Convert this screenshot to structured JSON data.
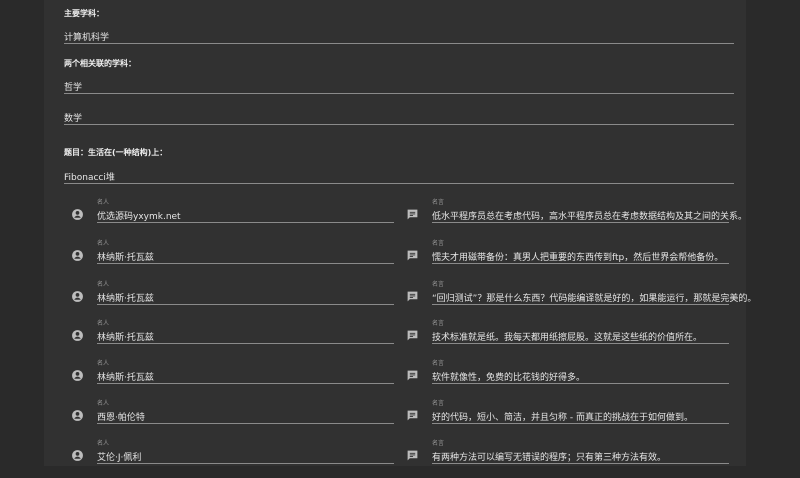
{
  "fields": {
    "main_subject_label": "主要学科：",
    "main_subject_value": "计算机科学",
    "related_subjects_label": "两个相关联的学科：",
    "related_subject_1": "哲学",
    "related_subject_2": "数学",
    "topic_label": "题目：生活在(一种结构)上：",
    "topic_value": "Fibonacci堆"
  },
  "quote_rows": [
    {
      "name_label": "名人",
      "name": "优选源码yxymk.net",
      "quote_label": "名言",
      "quote": "低水平程序员总在考虑代码，高水平程序员总在考虑数据结构及其之间的关系。"
    },
    {
      "name_label": "名人",
      "name": "林纳斯·托瓦兹",
      "quote_label": "名言",
      "quote": "懦夫才用磁带备份：真男人把重要的东西传到ftp，然后世界会帮他备份。"
    },
    {
      "name_label": "名人",
      "name": "林纳斯·托瓦兹",
      "quote_label": "名言",
      "quote": "“回归测试”？那是什么东西？代码能编译就是好的，如果能运行，那就是完美的。"
    },
    {
      "name_label": "名人",
      "name": "林纳斯·托瓦兹",
      "quote_label": "名言",
      "quote": "技术标准就是纸。我每天都用纸擦屁股。这就是这些纸的价值所在。"
    },
    {
      "name_label": "名人",
      "name": "林纳斯·托瓦兹",
      "quote_label": "名言",
      "quote": "软件就像性，免费的比花钱的好得多。"
    },
    {
      "name_label": "名人",
      "name": "西恩·帕伦特",
      "quote_label": "名言",
      "quote": "好的代码，短小、简洁，并且匀称 - 而真正的挑战在于如何做到。"
    },
    {
      "name_label": "名人",
      "name": "艾伦·J·佩利",
      "quote_label": "名言",
      "quote": "有两种方法可以编写无错误的程序；只有第三种方法有效。"
    }
  ]
}
